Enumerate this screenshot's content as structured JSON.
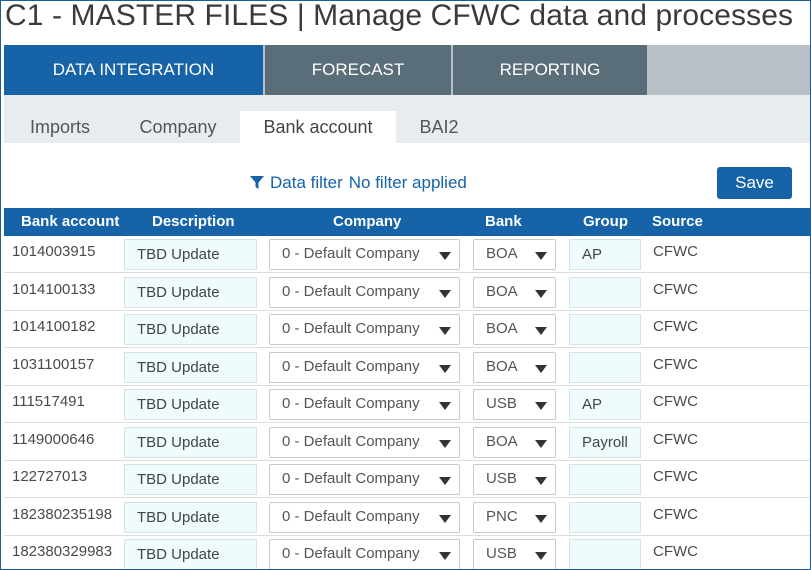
{
  "title": "C1 - MASTER FILES | Manage CFWC data and processes",
  "main_tabs": [
    "DATA INTEGRATION",
    "FORECAST",
    "REPORTING"
  ],
  "sub_tabs": [
    "Imports",
    "Company",
    "Bank account",
    "BAI2"
  ],
  "active_sub_tab": "Bank account",
  "filter": {
    "label": "Data filter",
    "status": "No filter applied"
  },
  "save_label": "Save",
  "columns": [
    "Bank account",
    "Description",
    "Company",
    "Bank",
    "Group",
    "Source"
  ],
  "rows": [
    {
      "account": "1014003915",
      "description": "TBD Update",
      "company": "0 - Default Company",
      "bank": "BOA",
      "group": "AP",
      "source": "CFWC"
    },
    {
      "account": "1014100133",
      "description": "TBD Update",
      "company": "0 - Default Company",
      "bank": "BOA",
      "group": "",
      "source": "CFWC"
    },
    {
      "account": "1014100182",
      "description": "TBD Update",
      "company": "0 - Default Company",
      "bank": "BOA",
      "group": "",
      "source": "CFWC"
    },
    {
      "account": "1031100157",
      "description": "TBD Update",
      "company": "0 - Default Company",
      "bank": "BOA",
      "group": "",
      "source": "CFWC"
    },
    {
      "account": "111517491",
      "description": "TBD Update",
      "company": "0 - Default Company",
      "bank": "USB",
      "group": "AP",
      "source": "CFWC"
    },
    {
      "account": "1149000646",
      "description": "TBD Update",
      "company": "0 - Default Company",
      "bank": "BOA",
      "group": "Payroll",
      "source": "CFWC"
    },
    {
      "account": "122727013",
      "description": "TBD Update",
      "company": "0 - Default Company",
      "bank": "USB",
      "group": "",
      "source": "CFWC"
    },
    {
      "account": "182380235198",
      "description": "TBD Update",
      "company": "0 - Default Company",
      "bank": "PNC",
      "group": "",
      "source": "CFWC"
    },
    {
      "account": "182380329983",
      "description": "TBD Update",
      "company": "0 - Default Company",
      "bank": "USB",
      "group": "",
      "source": "CFWC"
    }
  ],
  "colors": {
    "primary": "#1663a8",
    "tab_inactive": "#5a6e79",
    "tab_strip": "#b8c0c6",
    "input_bg": "#f0fbfd"
  }
}
